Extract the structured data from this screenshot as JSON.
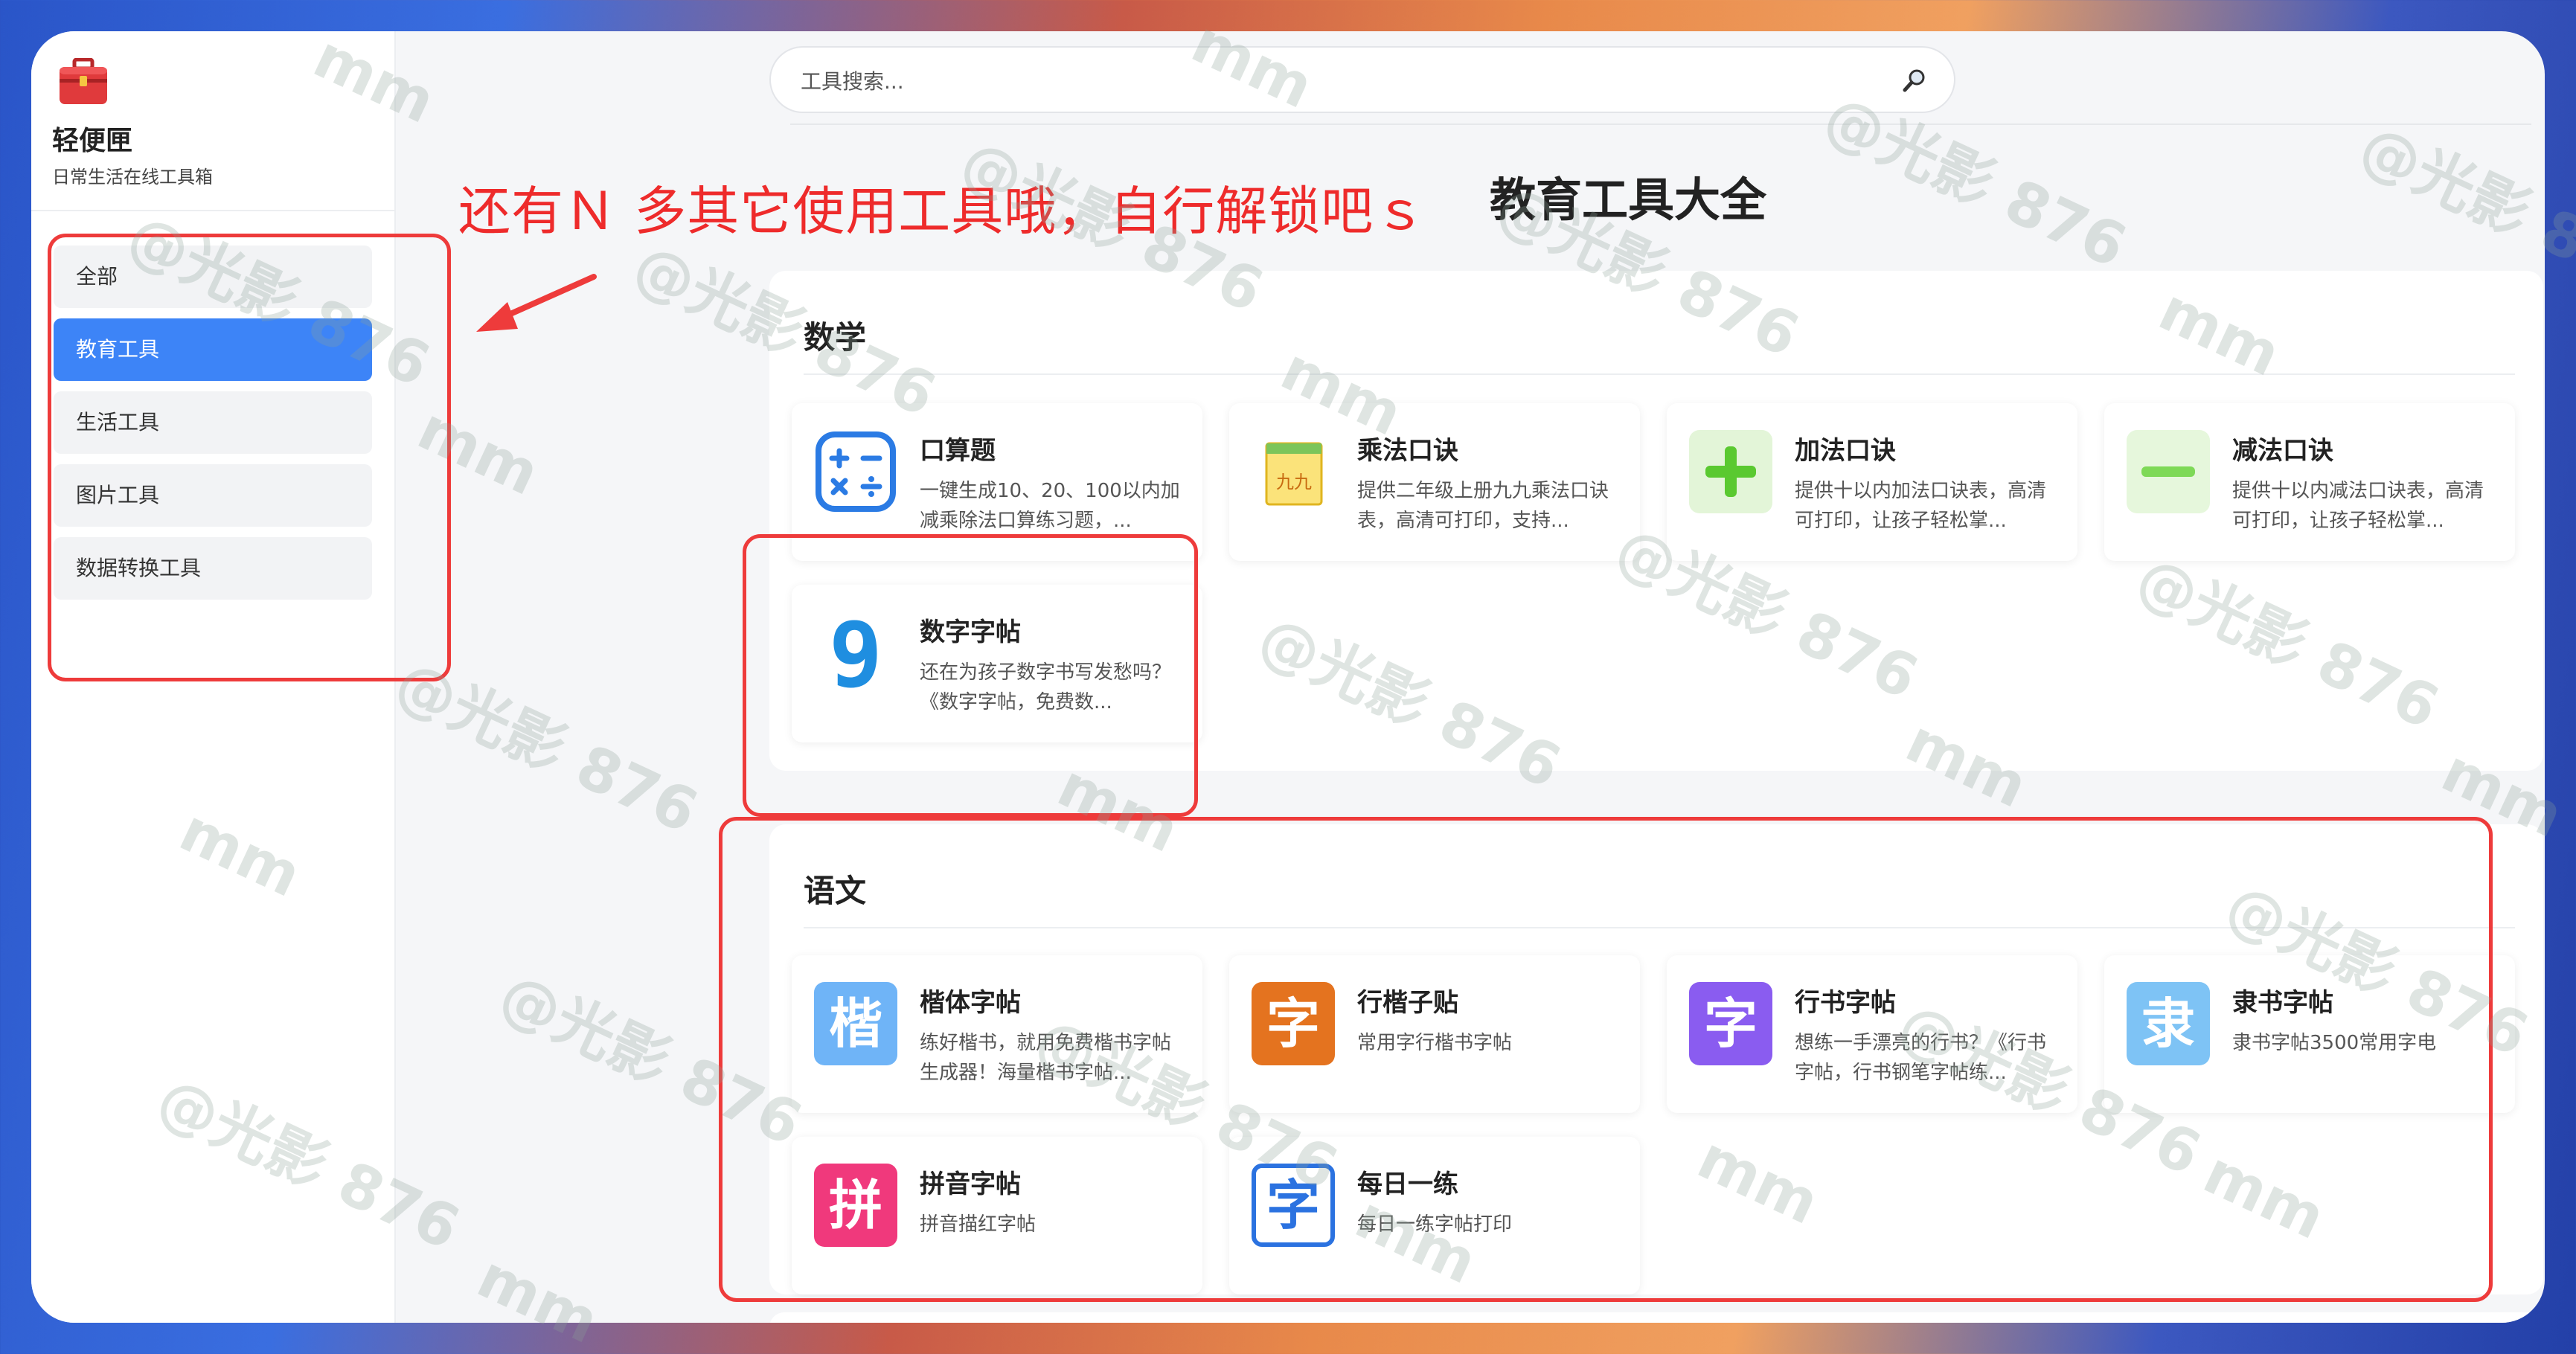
{
  "app": {
    "title": "轻便匣",
    "subtitle": "日常生活在线工具箱"
  },
  "nav": [
    {
      "label": "全部",
      "active": false
    },
    {
      "label": "教育工具",
      "active": true
    },
    {
      "label": "生活工具",
      "active": false
    },
    {
      "label": "图片工具",
      "active": false
    },
    {
      "label": "数据转换工具",
      "active": false
    }
  ],
  "search": {
    "placeholder": "工具搜索...",
    "icon": "magnifier-icon"
  },
  "page_title": "教育工具大全",
  "annotation": "还有Ｎ 多其它使用工具哦，自行解锁吧ｓ",
  "sections": [
    {
      "title": "数学",
      "tools": [
        {
          "title": "口算题",
          "desc": "一键生成10、20、100以内加减乘除法口算练习题，...",
          "icon": "math-operators-icon"
        },
        {
          "title": "乘法口诀",
          "desc": "提供二年级上册九九乘法口诀表，高清可打印，支持...",
          "icon": "multiplication-table-icon",
          "icon_text": "九九"
        },
        {
          "title": "加法口诀",
          "desc": "提供十以内加法口诀表，高清可打印，让孩子轻松掌...",
          "icon": "plus-icon"
        },
        {
          "title": "减法口诀",
          "desc": "提供十以内减法口诀表，高清可打印，让孩子轻松掌...",
          "icon": "minus-icon"
        },
        {
          "title": "数字字帖",
          "desc": "还在为孩子数字书写发愁吗？《数字字帖，免费数...",
          "icon": "digit-nine-icon",
          "icon_text": "9"
        }
      ]
    },
    {
      "title": "语文",
      "tools": [
        {
          "title": "楷体字帖",
          "desc": "练好楷书，就用免费楷书字帖生成器！海量楷书字帖...",
          "icon": "kai-char-icon",
          "icon_text": "楷"
        },
        {
          "title": "行楷子贴",
          "desc": "常用字行楷书字帖",
          "icon": "zi-char-icon",
          "icon_text": "字"
        },
        {
          "title": "行书字帖",
          "desc": "想练一手漂亮的行书？《行书字帖，行书钢笔字帖练...",
          "icon": "zi-char-icon",
          "icon_text": "字"
        },
        {
          "title": "隶书字帖",
          "desc": "隶书字帖3500常用字电",
          "icon": "li-char-icon",
          "icon_text": "隶"
        },
        {
          "title": "拼音字帖",
          "desc": "拼音描红字帖",
          "icon": "pin-char-icon",
          "icon_text": "拼"
        },
        {
          "title": "每日一练",
          "desc": "每日一练字帖打印",
          "icon": "zi-char-icon",
          "icon_text": "字"
        }
      ]
    }
  ],
  "colors": {
    "accent": "#3d84f7",
    "annotation_red": "#ee3b3b",
    "plus_green": "#5ac930",
    "minus_green": "#7ed957",
    "kai_blue": "#6fb4f7",
    "xingkai_orange": "#e4731f",
    "xingshu_purple": "#8a5cf0",
    "lishu_blue": "#7ec3f5",
    "pinyin_pink": "#f0397c",
    "daily_blue": "#2b72e0"
  },
  "watermark": {
    "handle": "@光影 876",
    "mark": "mm"
  }
}
